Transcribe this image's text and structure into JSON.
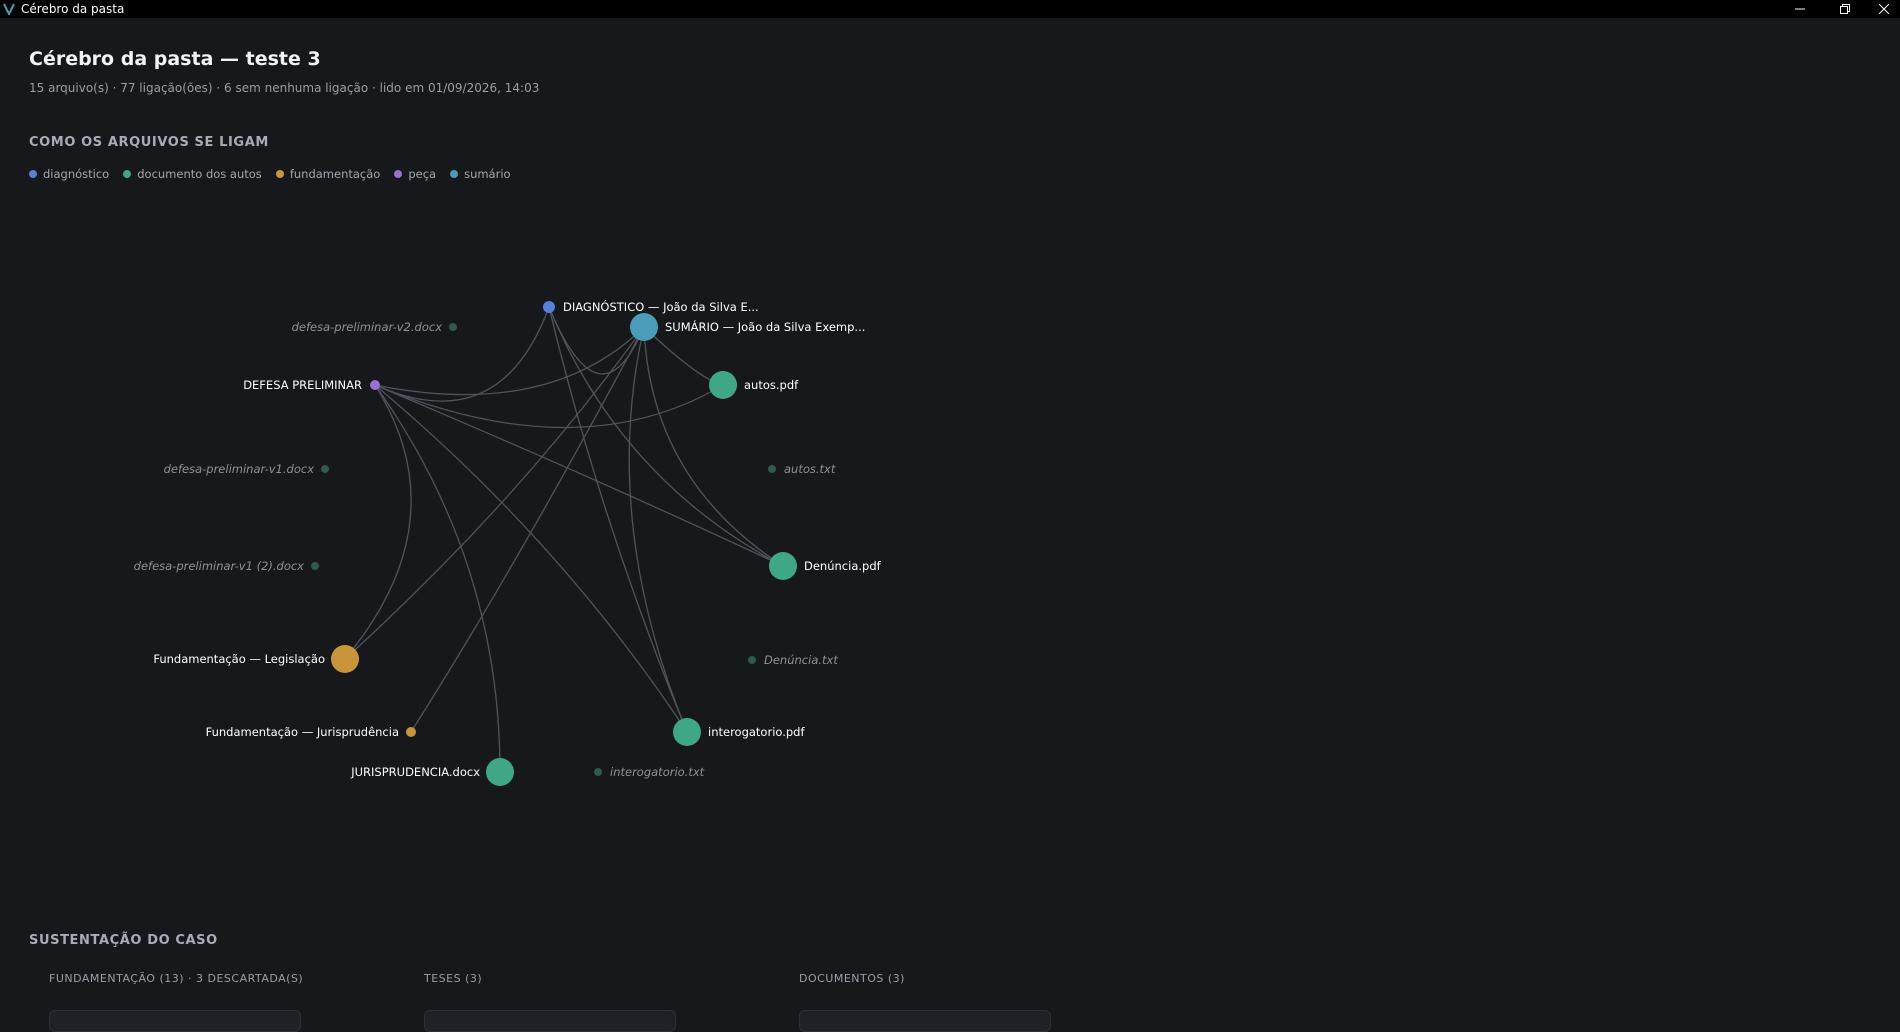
{
  "window": {
    "title": "Cérebro da pasta"
  },
  "header": {
    "title": "Cérebro da pasta — teste 3",
    "meta": "15 arquivo(s) · 77 ligação(ões) · 6 sem nenhuma ligação · lido em 01/09/2026, 14:03"
  },
  "graph_section": {
    "title": "COMO OS ARQUIVOS SE LIGAM",
    "legend": [
      {
        "label": "diagnóstico",
        "color": "#5a7fd6"
      },
      {
        "label": "documento dos autos",
        "color": "#3fa687"
      },
      {
        "label": "fundamentação",
        "color": "#c9953a"
      },
      {
        "label": "peça",
        "color": "#9b6fd6"
      },
      {
        "label": "sumário",
        "color": "#4a9cb8"
      }
    ]
  },
  "graph": {
    "nodes": [
      {
        "id": "diag",
        "label": "DIAGNÓSTICO — João da Silva E...",
        "category": "diagnóstico",
        "color": "#5a7fd6",
        "connected": true
      },
      {
        "id": "sum",
        "label": "SUMÁRIO — João da Silva Exemp...",
        "category": "sumário",
        "color": "#4a9cb8",
        "connected": true
      },
      {
        "id": "autospdf",
        "label": "autos.pdf",
        "category": "documento dos autos",
        "color": "#3fa687",
        "connected": true
      },
      {
        "id": "autostxt",
        "label": "autos.txt",
        "category": "documento dos autos",
        "color": "#2f5a4c",
        "connected": false
      },
      {
        "id": "denpdf",
        "label": "Denúncia.pdf",
        "category": "documento dos autos",
        "color": "#3fa687",
        "connected": true
      },
      {
        "id": "dentxt",
        "label": "Denúncia.txt",
        "category": "documento dos autos",
        "color": "#2f5a4c",
        "connected": false
      },
      {
        "id": "interpdf",
        "label": "interogatorio.pdf",
        "category": "documento dos autos",
        "color": "#3fa687",
        "connected": true
      },
      {
        "id": "intertxt",
        "label": "interogatorio.txt",
        "category": "documento dos autos",
        "color": "#2f5a4c",
        "connected": false
      },
      {
        "id": "juris",
        "label": "JURISPRUDENCIA.docx",
        "category": "documento dos autos",
        "color": "#3fa687",
        "connected": true
      },
      {
        "id": "fundjur",
        "label": "Fundamentação — Jurisprudência",
        "category": "fundamentação",
        "color": "#c9953a",
        "connected": true
      },
      {
        "id": "fundleg",
        "label": "Fundamentação — Legislação",
        "category": "fundamentação",
        "color": "#c9953a",
        "connected": true
      },
      {
        "id": "dpv1b",
        "label": "defesa-preliminar-v1 (2).docx",
        "category": "documento dos autos",
        "color": "#2f5a4c",
        "connected": false
      },
      {
        "id": "dpv1",
        "label": "defesa-preliminar-v1.docx",
        "category": "documento dos autos",
        "color": "#2f5a4c",
        "connected": false
      },
      {
        "id": "defesa",
        "label": "DEFESA PRELIMINAR",
        "category": "peça",
        "color": "#9b6fd6",
        "connected": true
      },
      {
        "id": "dpv2",
        "label": "defesa-preliminar-v2.docx",
        "category": "documento dos autos",
        "color": "#2f5a4c",
        "connected": false
      }
    ]
  },
  "support_section": {
    "title": "SUSTENTAÇÃO DO CASO",
    "columns": [
      {
        "title": "FUNDAMENTAÇÃO (13) · 3 DESCARTADA(S)"
      },
      {
        "title": "TESES (3)"
      },
      {
        "title": "DOCUMENTOS (3)"
      }
    ]
  }
}
